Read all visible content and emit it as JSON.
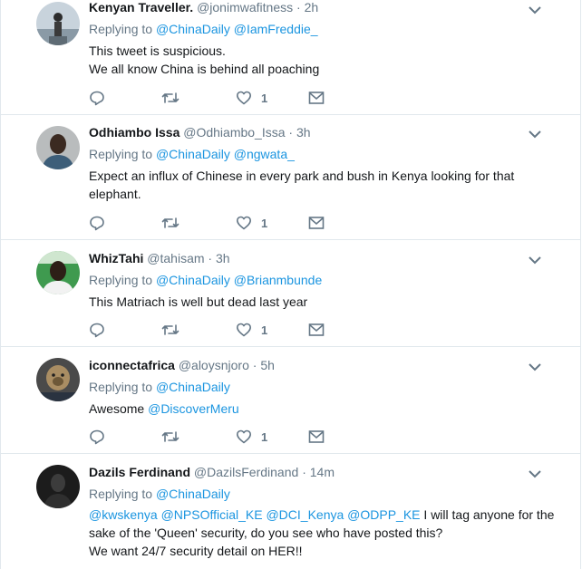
{
  "tweets": [
    {
      "name": "Kenyan Traveller.",
      "handle": "@jonimwafitness",
      "sep": "·",
      "time": "2h",
      "replying_label": "Replying to",
      "replying_to": [
        "@ChinaDaily",
        "@IamFreddie_"
      ],
      "lines": [
        "This tweet is suspicious.",
        "We all know China is behind all poaching"
      ],
      "likes": "1"
    },
    {
      "name": "Odhiambo Issa",
      "handle": "@Odhiambo_Issa",
      "sep": "·",
      "time": "3h",
      "replying_label": "Replying to",
      "replying_to": [
        "@ChinaDaily",
        "@ngwata_"
      ],
      "lines": [
        "Expect an influx of Chinese in every park and bush in Kenya looking for that",
        "elephant."
      ],
      "likes": "1"
    },
    {
      "name": "WhizTahi",
      "handle": "@tahisam",
      "sep": "·",
      "time": "3h",
      "replying_label": "Replying to",
      "replying_to": [
        "@ChinaDaily",
        "@Brianmbunde"
      ],
      "lines": [
        "This Matriach is well but dead last year"
      ],
      "likes": "1"
    },
    {
      "name": "iconnectafrica",
      "handle": "@aloysnjoro",
      "sep": "·",
      "time": "5h",
      "replying_label": "Replying to",
      "replying_to": [
        "@ChinaDaily"
      ],
      "text_prefix": "Awesome",
      "text_mention": "@DiscoverMeru",
      "likes": "1"
    },
    {
      "name": "Dazils Ferdinand",
      "handle": "@DazilsFerdinand",
      "sep": "·",
      "time": "14m",
      "replying_label": "Replying to",
      "replying_to": [
        "@ChinaDaily"
      ],
      "body_mentions": [
        "@kwskenya",
        "@NPSOfficial_KE",
        "@DCI_Kenya",
        "@ODPP_KE"
      ],
      "body_line1_rest": "I will tag anyone for the",
      "body_line2": "sake of the 'Queen' security, do you see who have posted this?",
      "body_line3": "We want 24/7 security detail on HER!!"
    }
  ],
  "icons": [
    "reply-icon",
    "retweet-icon",
    "like-icon",
    "message-icon",
    "chevron-down-icon"
  ],
  "colors": {
    "mention": "#1b95e0",
    "muted": "#657786",
    "divider": "#e1e8ed",
    "text": "#14171a"
  }
}
